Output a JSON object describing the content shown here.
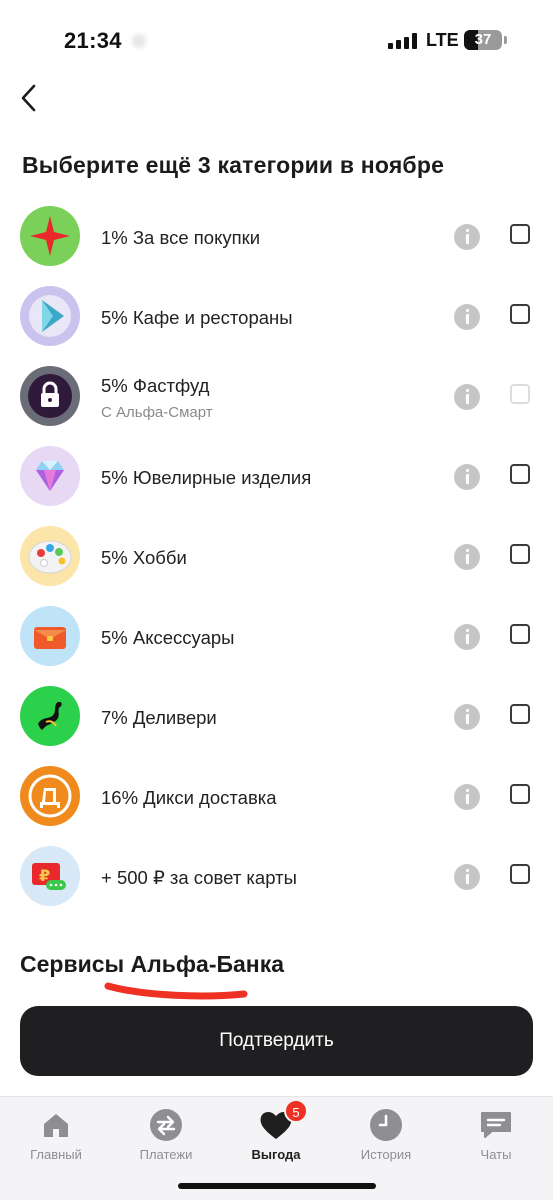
{
  "status_bar": {
    "time": "21:34",
    "network": "LTE",
    "battery": "37",
    "battery_level": 0.37
  },
  "page": {
    "title": "Выберите ещё 3 категории в ноябре"
  },
  "categories": [
    {
      "label": "1% За все покупки",
      "sub": "",
      "icon": "red-star-icon",
      "checked": false,
      "disabled": false
    },
    {
      "label": "5% Кафе и рестораны",
      "sub": "",
      "icon": "play-triangle-icon",
      "checked": false,
      "disabled": false
    },
    {
      "label": "5% Фастфуд",
      "sub": "С Альфа-Смарт",
      "icon": "lock-icon",
      "checked": false,
      "disabled": true
    },
    {
      "label": "5% Ювелирные изделия",
      "sub": "",
      "icon": "diamond-icon",
      "checked": false,
      "disabled": false
    },
    {
      "label": "5% Хобби",
      "sub": "",
      "icon": "palette-icon",
      "checked": false,
      "disabled": false
    },
    {
      "label": "5% Аксессуары",
      "sub": "",
      "icon": "handbag-icon",
      "checked": false,
      "disabled": false
    },
    {
      "label": "7% Деливери",
      "sub": "",
      "icon": "delivery-ostrich-icon",
      "checked": false,
      "disabled": false
    },
    {
      "label": "16% Дикси доставка",
      "sub": "",
      "icon": "dixy-logo-icon",
      "checked": false,
      "disabled": false
    },
    {
      "label": "+ 500 ₽ за совет карты",
      "sub": "",
      "icon": "ruble-card-icon",
      "checked": false,
      "disabled": false
    }
  ],
  "services": {
    "title": "Сервисы Альфа-Банка"
  },
  "confirm": {
    "label": "Подтвердить"
  },
  "tabbar": {
    "tabs": [
      {
        "label": "Главный",
        "icon": "home-icon",
        "active": false
      },
      {
        "label": "Платежи",
        "icon": "transfer-arrows-icon",
        "active": false
      },
      {
        "label": "Выгода",
        "icon": "heart-icon",
        "active": true,
        "badge": "5"
      },
      {
        "label": "История",
        "icon": "clock-icon",
        "active": false
      },
      {
        "label": "Чаты",
        "icon": "chat-bubble-icon",
        "active": false
      }
    ]
  },
  "colors": {
    "accent_red": "#ef3124",
    "button_dark": "#1f1f21",
    "muted": "#8e8e93"
  }
}
